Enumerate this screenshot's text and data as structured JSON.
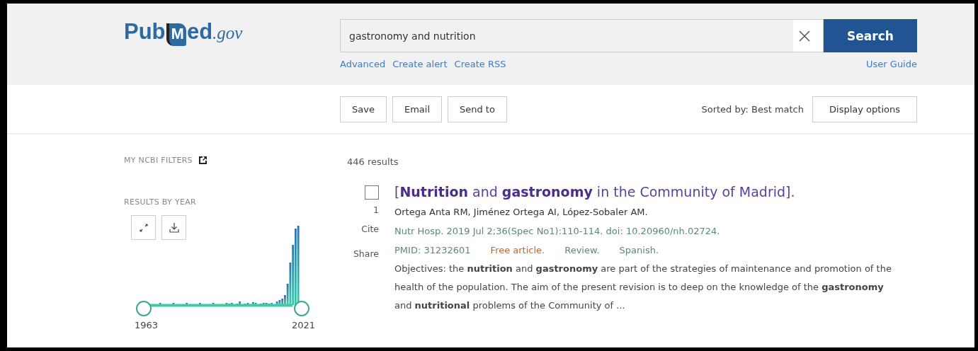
{
  "header": {
    "logo": {
      "part1": "Pub",
      "book_letter": "M",
      "part2": "ed",
      "suffix": ".gov"
    },
    "search": {
      "value": "gastronomy and nutrition",
      "button": "Search"
    },
    "links": [
      "Advanced",
      "Create alert",
      "Create RSS"
    ],
    "user_guide": "User Guide"
  },
  "toolbar": {
    "buttons": [
      "Save",
      "Email",
      "Send to"
    ],
    "sort": "Sorted by: Best match",
    "display_options": "Display options"
  },
  "sidebar": {
    "filters": "MY NCBI FILTERS",
    "results_by_year": "RESULTS BY YEAR",
    "year_start": "1963",
    "year_end": "2021"
  },
  "results": {
    "count": "446 results",
    "articles": [
      {
        "number": "1",
        "selected": false,
        "cite": "Cite",
        "share": "Share",
        "title": "[**Nutrition** and **gastronomy** in the Community of Madrid].",
        "authors": "Ortega Anta RM, Jiménez Ortega AI, López-Sobaler AM.",
        "citation": "Nutr Hosp. 2019 Jul 2;36(Spec No1):110-114. doi: 10.20960/nh.02724.",
        "pmid": "PMID: 31232601",
        "free": "Free article.",
        "type": "Review.",
        "language": "Spanish.",
        "snippet": "Objectives: the **nutrition** and **gastronomy** are part of the strategies of maintenance and promotion of the health of the population. The aim of the present revision is to deep on the knowledge of the **gastronomy** and **nutritional** problems of the Community of ..."
      }
    ]
  }
}
